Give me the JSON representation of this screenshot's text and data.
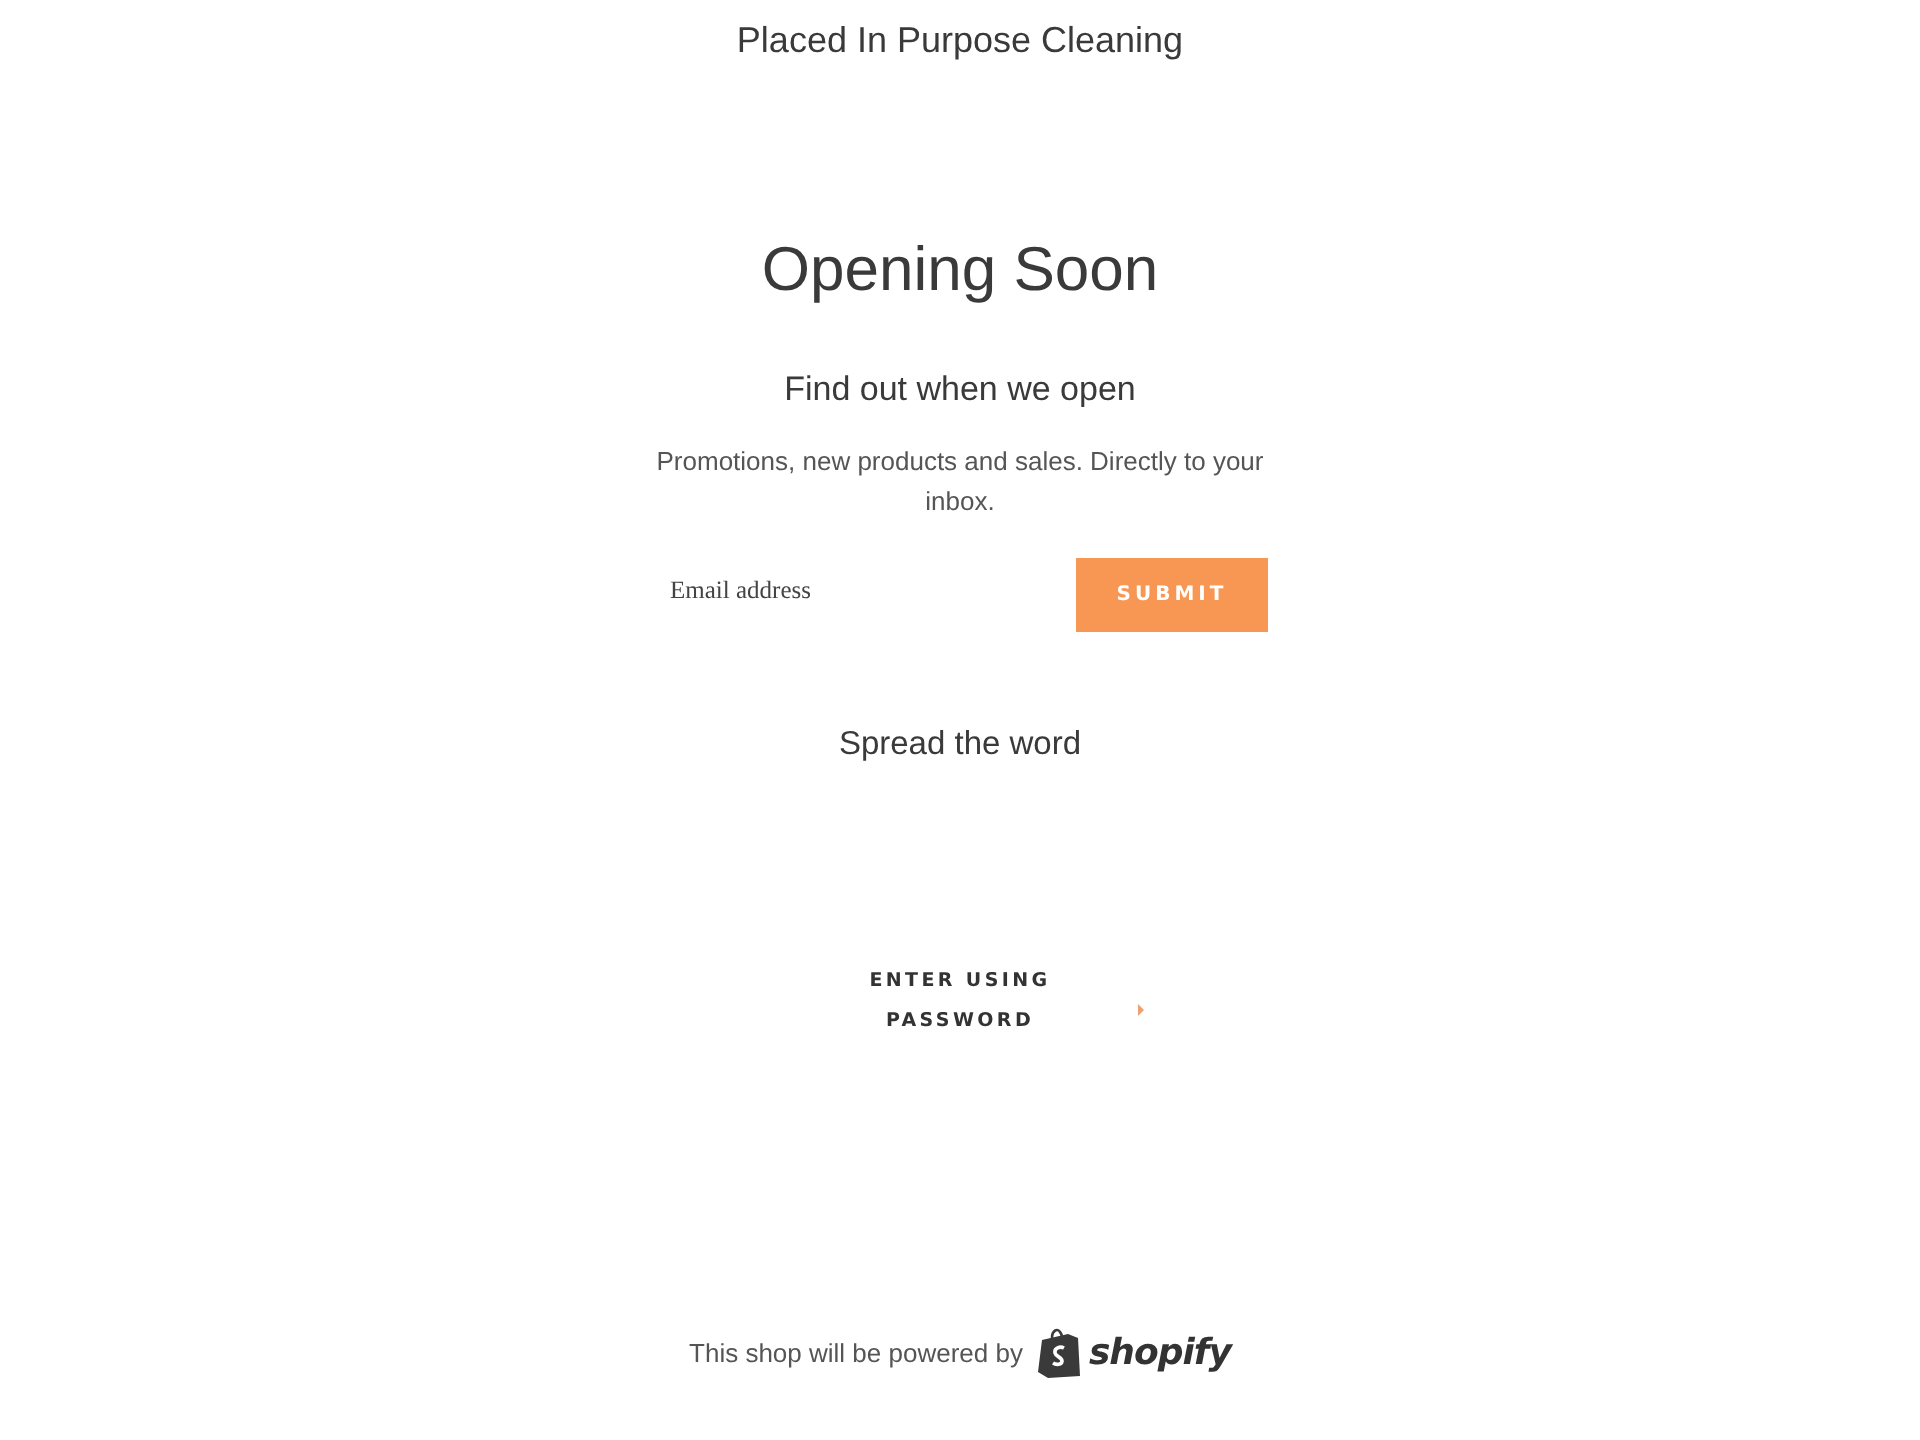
{
  "header": {
    "shop_name": "Placed In Purpose Cleaning"
  },
  "main": {
    "heading": "Opening Soon",
    "subheading": "Find out when we open",
    "description": "Promotions, new products and sales. Directly to your inbox."
  },
  "signup_form": {
    "email_field": {
      "placeholder": "Email address"
    },
    "submit_button": "SUBMIT"
  },
  "share": {
    "heading": "Spread the word"
  },
  "password_link": {
    "label": "ENTER USING PASSWORD"
  },
  "footer": {
    "text": "This shop will be powered by",
    "logo_wordmark": "shopify"
  }
}
